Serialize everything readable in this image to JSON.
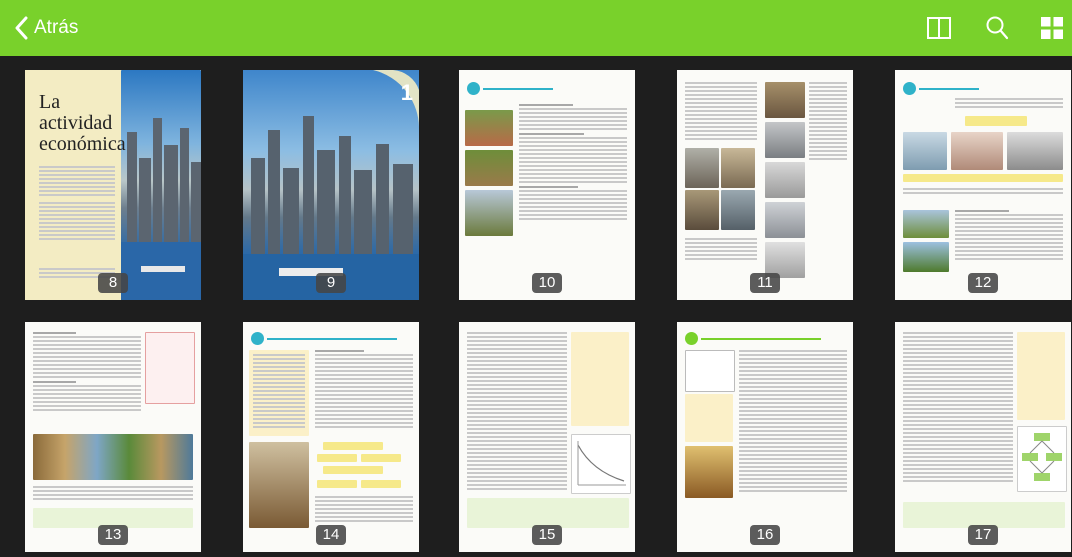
{
  "header": {
    "back_label": "Atrás"
  },
  "book": {
    "title_line1": "La",
    "title_line2": "actividad",
    "title_line3": "económica"
  },
  "chapter_number": "1",
  "pages": [
    {
      "number": "8"
    },
    {
      "number": "9"
    },
    {
      "number": "10"
    },
    {
      "number": "11"
    },
    {
      "number": "12"
    },
    {
      "number": "13"
    },
    {
      "number": "14"
    },
    {
      "number": "15"
    },
    {
      "number": "16"
    },
    {
      "number": "17"
    }
  ],
  "colors": {
    "accent": "#79d12b",
    "background": "#1e1e1e",
    "chapter_color": "#2fb2c9"
  },
  "icons": {
    "back": "chevron-left-icon",
    "book": "book-icon",
    "search": "search-icon",
    "grid": "grid-view-icon"
  }
}
